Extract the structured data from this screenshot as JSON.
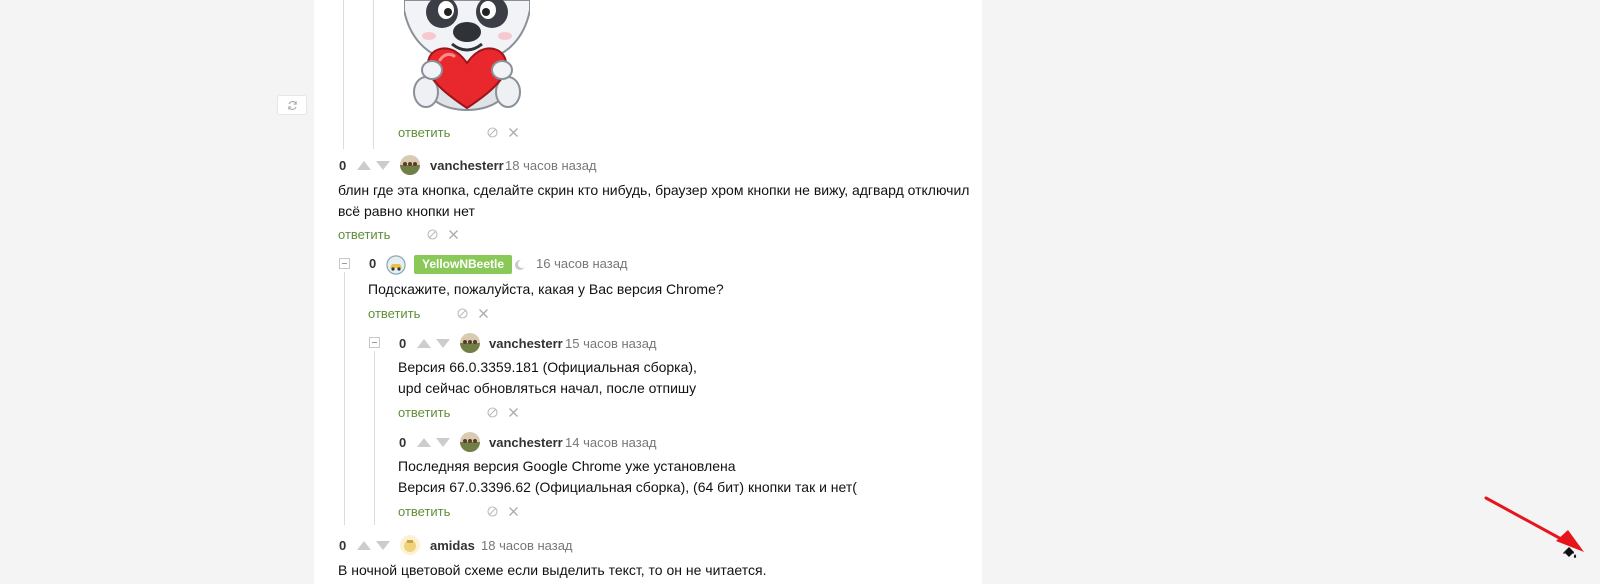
{
  "comments": [
    {
      "id": "c1",
      "score": "0",
      "author": "vanchesterr",
      "time": "18 часов назад",
      "lines": [
        "блин где эта кнопка, сделайте скрин кто нибудь, браузер хром кнопки не вижу, адгвард отключил",
        "всё равно кнопки нет"
      ],
      "reply": "ответить"
    },
    {
      "id": "c2",
      "score": "0",
      "author": "YellowNBeetle",
      "time": "16 часов назад",
      "lines": [
        "Подскажите, пожалуйста, какая у Вас версия Chrome?"
      ],
      "reply": "ответить"
    },
    {
      "id": "c3",
      "score": "0",
      "author": "vanchesterr",
      "time": "15 часов назад",
      "lines": [
        "Версия 66.0.3359.181 (Официальная сборка),",
        "upd сейчас обновляться начал, после отпишу"
      ],
      "reply": "ответить"
    },
    {
      "id": "c4",
      "score": "0",
      "author": "vanchesterr",
      "time": "14 часов назад",
      "lines": [
        "Последняя версия Google Chrome уже установлена",
        "Версия 67.0.3396.62 (Официальная сборка), (64 бит) кнопки так и нет("
      ],
      "reply": "ответить"
    },
    {
      "id": "c5",
      "score": "0",
      "author": "amidas",
      "time": "18 часов назад",
      "lines": [
        "В ночной цветовой схеме если выделить текст, то он не читается."
      ],
      "reply": ""
    }
  ],
  "sticker_reply": "ответить",
  "colors": {
    "accent_green": "#5f8f3b",
    "badge_green": "#8ac858",
    "page_bg": "#f4f4f4",
    "arrow_red": "#e8141c"
  },
  "icons": [
    "refresh-icon",
    "vote-up-icon",
    "vote-down-icon",
    "block-icon",
    "close-icon",
    "collapse-icon",
    "paint-bucket-icon"
  ]
}
